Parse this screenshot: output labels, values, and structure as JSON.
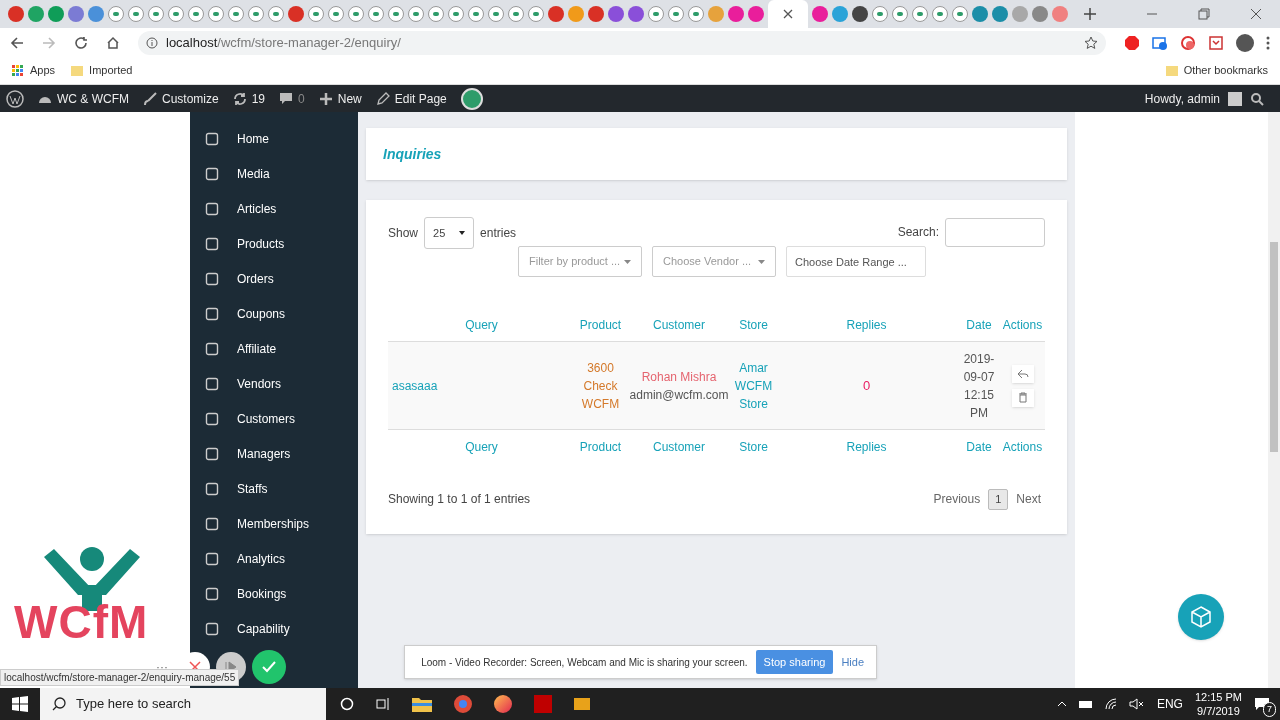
{
  "browser": {
    "url_host": "localhost",
    "url_path": "/wcfm/store-manager-2/enquiry/",
    "bookmarks": [
      "Apps",
      "Imported"
    ],
    "other_bookmarks": "Other bookmarks"
  },
  "admin_bar": {
    "site": "WC & WCFM",
    "customize": "Customize",
    "updates": "19",
    "comments": "0",
    "new": "New",
    "edit": "Edit Page",
    "greeting": "Howdy, admin"
  },
  "sidebar": {
    "items": [
      "Home",
      "Media",
      "Articles",
      "Products",
      "Orders",
      "Coupons",
      "Affiliate",
      "Vendors",
      "Customers",
      "Managers",
      "Staffs",
      "Memberships",
      "Analytics",
      "Bookings",
      "Capability"
    ]
  },
  "page_title": "Inquiries",
  "controls": {
    "show_label": "Show",
    "page_size": "25",
    "entries_label": "entries",
    "search_label": "Search:",
    "filters": [
      {
        "placeholder": "Filter by product ...",
        "kind": "select"
      },
      {
        "placeholder": "Choose Vendor ...",
        "kind": "select"
      },
      {
        "placeholder": "Choose Date Range ...",
        "kind": "input"
      }
    ]
  },
  "table": {
    "columns": [
      "Query",
      "Product",
      "Customer",
      "Store",
      "Replies",
      "Date",
      "Actions"
    ],
    "rows": [
      {
        "query": "asasaaa",
        "product": "3600 Check WCFM",
        "customer_name": "Rohan Mishra",
        "customer_email": "admin@wcfm.com",
        "store": "Amar WCFM Store",
        "replies": "0",
        "date": "2019-09-07 12:15 PM"
      }
    ],
    "footer_columns": [
      "Query",
      "Product",
      "Customer",
      "Store",
      "Replies",
      "Date",
      "Actions"
    ]
  },
  "info": "Showing 1 to 1 of 1 entries",
  "pagination": {
    "previous": "Previous",
    "pages": [
      {
        "label": "1",
        "selected": true
      }
    ],
    "next": "Next"
  },
  "logo": {
    "text": "WCfM"
  },
  "loom": {
    "message": "Loom - Video Recorder: Screen, Webcam and Mic is sharing your screen.",
    "stop": "Stop sharing",
    "hide": "Hide",
    "more": "···"
  },
  "status_url": "localhost/wcfm/store-manager-2/enquiry-manage/55",
  "taskbar": {
    "search_placeholder": "Type here to search",
    "language": "ENG",
    "time": "12:15 PM",
    "date": "9/7/2019",
    "notifications": "7"
  }
}
